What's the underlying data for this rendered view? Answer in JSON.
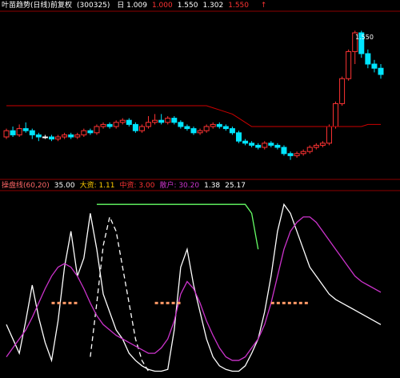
{
  "colors": {
    "background": "#000000",
    "separator": "#8b0000",
    "candle_up": "#ff3333",
    "candle_down": "#00e5ff",
    "doji": "#ffffff",
    "ma_line": "#cc0000",
    "white_line": "#ffffff",
    "magenta_line": "#cc33cc",
    "green_line": "#66ff66",
    "dashed_marker": "#ff9966",
    "accent_yellow": "#ffcc00"
  },
  "top_header": {
    "title": "叶苗趋势(日线)前复权",
    "code": "(300325)",
    "values": [
      {
        "text": "日 1.009",
        "color": "#ffffff"
      },
      {
        "text": "1.000",
        "color": "#ff3333"
      },
      {
        "text": "1.550",
        "color": "#ffffff"
      },
      {
        "text": "1.302",
        "color": "#ffffff"
      },
      {
        "text": "1.550",
        "color": "#ff3333"
      }
    ],
    "arrow": "↑"
  },
  "bottom_header": {
    "values": [
      {
        "text": "操盘线(60,20)",
        "color": "#ff6666"
      },
      {
        "text": "35.00",
        "color": "#ffffff"
      },
      {
        "text": "大资: 1.11",
        "color": "#ffcc00"
      },
      {
        "text": "中资: 3.00",
        "color": "#ff3333"
      },
      {
        "text": "散户: 30.20",
        "color": "#cc33cc"
      },
      {
        "text": "1.38",
        "color": "#ffffff"
      },
      {
        "text": "25.17",
        "color": "#ffffff"
      }
    ]
  },
  "annotations": {
    "price_high_label": "1.550",
    "price_low_label": "1.000"
  },
  "chart_data": [
    {
      "type": "candlestick",
      "panel": "top",
      "ylim": [
        0.9,
        1.6
      ],
      "grid": false,
      "candles": [
        [
          1.05,
          1.08,
          1.09,
          1.04
        ],
        [
          1.08,
          1.06,
          1.1,
          1.05
        ],
        [
          1.06,
          1.09,
          1.11,
          1.05
        ],
        [
          1.09,
          1.08,
          1.12,
          1.07
        ],
        [
          1.08,
          1.06,
          1.09,
          1.04
        ],
        [
          1.06,
          1.05,
          1.07,
          1.03
        ],
        [
          1.05,
          1.05,
          1.06,
          1.04
        ],
        [
          1.05,
          1.04,
          1.06,
          1.03
        ],
        [
          1.04,
          1.05,
          1.06,
          1.03
        ],
        [
          1.05,
          1.06,
          1.07,
          1.04
        ],
        [
          1.06,
          1.05,
          1.07,
          1.04
        ],
        [
          1.05,
          1.06,
          1.07,
          1.04
        ],
        [
          1.06,
          1.08,
          1.09,
          1.05
        ],
        [
          1.08,
          1.07,
          1.09,
          1.06
        ],
        [
          1.07,
          1.1,
          1.11,
          1.06
        ],
        [
          1.1,
          1.11,
          1.12,
          1.09
        ],
        [
          1.11,
          1.1,
          1.12,
          1.09
        ],
        [
          1.1,
          1.12,
          1.13,
          1.09
        ],
        [
          1.12,
          1.13,
          1.14,
          1.11
        ],
        [
          1.13,
          1.11,
          1.14,
          1.1
        ],
        [
          1.11,
          1.08,
          1.12,
          1.07
        ],
        [
          1.08,
          1.1,
          1.11,
          1.07
        ],
        [
          1.1,
          1.12,
          1.15,
          1.09
        ],
        [
          1.12,
          1.13,
          1.16,
          1.11
        ],
        [
          1.13,
          1.12,
          1.16,
          1.11
        ],
        [
          1.12,
          1.14,
          1.15,
          1.11
        ],
        [
          1.14,
          1.12,
          1.15,
          1.11
        ],
        [
          1.12,
          1.1,
          1.13,
          1.09
        ],
        [
          1.1,
          1.09,
          1.11,
          1.08
        ],
        [
          1.09,
          1.07,
          1.1,
          1.06
        ],
        [
          1.07,
          1.08,
          1.09,
          1.06
        ],
        [
          1.08,
          1.1,
          1.11,
          1.07
        ],
        [
          1.1,
          1.11,
          1.12,
          1.09
        ],
        [
          1.11,
          1.1,
          1.12,
          1.09
        ],
        [
          1.1,
          1.09,
          1.11,
          1.08
        ],
        [
          1.09,
          1.07,
          1.1,
          1.06
        ],
        [
          1.07,
          1.03,
          1.08,
          1.02
        ],
        [
          1.03,
          1.02,
          1.04,
          1.01
        ],
        [
          1.02,
          1.01,
          1.03,
          1.0
        ],
        [
          1.01,
          1.0,
          1.02,
          0.99
        ],
        [
          1.0,
          1.02,
          1.03,
          0.99
        ],
        [
          1.02,
          1.01,
          1.03,
          1.0
        ],
        [
          1.01,
          1.0,
          1.02,
          0.99
        ],
        [
          1.0,
          0.97,
          1.01,
          0.96
        ],
        [
          0.97,
          0.96,
          0.98,
          0.94
        ],
        [
          0.96,
          0.97,
          0.98,
          0.95
        ],
        [
          0.97,
          0.98,
          0.99,
          0.96
        ],
        [
          0.98,
          1.0,
          1.01,
          0.97
        ],
        [
          1.0,
          1.01,
          1.02,
          0.99
        ],
        [
          1.01,
          1.02,
          1.03,
          1.0
        ],
        [
          1.02,
          1.1,
          1.11,
          1.01
        ],
        [
          1.1,
          1.21,
          1.22,
          1.09
        ],
        [
          1.21,
          1.33,
          1.34,
          1.2
        ],
        [
          1.33,
          1.46,
          1.47,
          1.32
        ],
        [
          1.46,
          1.55,
          1.56,
          1.4
        ],
        [
          1.55,
          1.45,
          1.56,
          1.43
        ],
        [
          1.45,
          1.4,
          1.47,
          1.38
        ],
        [
          1.4,
          1.38,
          1.42,
          1.36
        ],
        [
          1.38,
          1.35,
          1.4,
          1.33
        ]
      ],
      "ma": [
        1.2,
        1.2,
        1.2,
        1.2,
        1.2,
        1.2,
        1.2,
        1.2,
        1.2,
        1.2,
        1.2,
        1.2,
        1.2,
        1.2,
        1.2,
        1.2,
        1.2,
        1.2,
        1.2,
        1.2,
        1.2,
        1.2,
        1.2,
        1.2,
        1.2,
        1.2,
        1.2,
        1.2,
        1.2,
        1.2,
        1.2,
        1.2,
        1.19,
        1.18,
        1.17,
        1.16,
        1.14,
        1.12,
        1.1,
        1.1,
        1.1,
        1.1,
        1.1,
        1.1,
        1.1,
        1.1,
        1.1,
        1.1,
        1.1,
        1.1,
        1.1,
        1.1,
        1.1,
        1.1,
        1.1,
        1.1,
        1.11,
        1.11,
        1.11
      ]
    },
    {
      "type": "line",
      "panel": "bottom",
      "ylim": [
        0,
        100
      ],
      "grid": false,
      "series": [
        {
          "key": "white",
          "dashed": false,
          "values": [
            28,
            20,
            12,
            30,
            50,
            32,
            18,
            8,
            30,
            60,
            80,
            55,
            65,
            90,
            70,
            45,
            35,
            25,
            20,
            12,
            8,
            5,
            3,
            2,
            2,
            3,
            25,
            60,
            70,
            50,
            35,
            20,
            10,
            5,
            3,
            2,
            2,
            5,
            12,
            20,
            35,
            55,
            80,
            95,
            90,
            80,
            70,
            60,
            55,
            50,
            45,
            42,
            40,
            38,
            36,
            34,
            32,
            30,
            28
          ]
        },
        {
          "key": "white_dashed",
          "dashed": true,
          "values": [
            null,
            null,
            null,
            null,
            null,
            null,
            null,
            null,
            null,
            null,
            null,
            null,
            null,
            10,
            40,
            72,
            88,
            80,
            60,
            40,
            20,
            8,
            2,
            null,
            null,
            null,
            null,
            null,
            null,
            null,
            null,
            null,
            null,
            null,
            null,
            null,
            null,
            null,
            null,
            null,
            null,
            null,
            null,
            null,
            null,
            null,
            null,
            null,
            null,
            null,
            null,
            null,
            null,
            null,
            null,
            null,
            null,
            null,
            null
          ]
        },
        {
          "key": "magenta",
          "dashed": false,
          "values": [
            10,
            15,
            20,
            25,
            32,
            40,
            48,
            55,
            60,
            62,
            60,
            55,
            48,
            40,
            33,
            28,
            25,
            22,
            20,
            18,
            16,
            14,
            12,
            12,
            15,
            20,
            30,
            45,
            52,
            48,
            40,
            30,
            22,
            15,
            10,
            8,
            8,
            10,
            15,
            20,
            28,
            40,
            55,
            70,
            80,
            85,
            88,
            88,
            85,
            80,
            75,
            70,
            65,
            60,
            55,
            52,
            50,
            48,
            46
          ]
        },
        {
          "key": "green",
          "dashed": false,
          "values": [
            null,
            null,
            null,
            null,
            null,
            null,
            null,
            null,
            null,
            null,
            null,
            null,
            null,
            null,
            95,
            95,
            95,
            95,
            95,
            95,
            95,
            95,
            95,
            95,
            95,
            95,
            95,
            95,
            95,
            95,
            95,
            95,
            95,
            95,
            95,
            95,
            95,
            95,
            90,
            70,
            null,
            null,
            null,
            null,
            null,
            null,
            null,
            null,
            null,
            null,
            null,
            null,
            null,
            null,
            null,
            null,
            null,
            null,
            null
          ]
        }
      ]
    }
  ]
}
